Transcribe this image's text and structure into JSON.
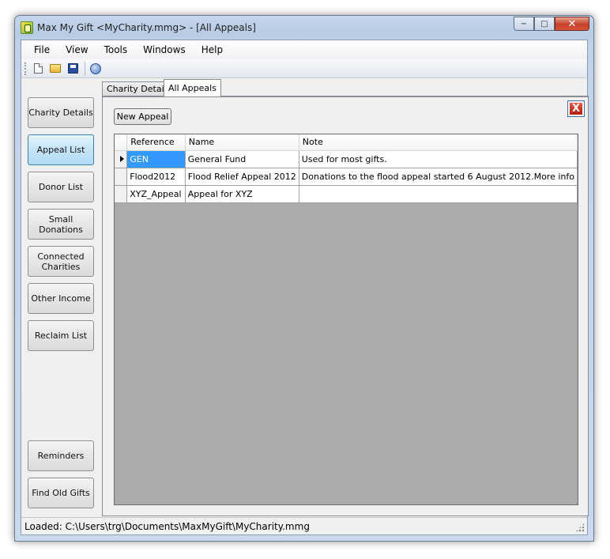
{
  "window": {
    "title": "Max My Gift <MyCharity.mmg>  - [All Appeals]",
    "minimize_label": "−",
    "maximize_label": "□",
    "close_label": "✕"
  },
  "menu": {
    "file": "File",
    "view": "View",
    "tools": "Tools",
    "windows": "Windows",
    "help": "Help"
  },
  "toolbar": {
    "icons": [
      "new-document-icon",
      "open-folder-icon",
      "save-disk-icon",
      "database-icon"
    ]
  },
  "sidebar": {
    "charity_details": "Charity Details",
    "appeal_list": "Appeal List",
    "donor_list": "Donor List",
    "small_donations_1": "Small",
    "small_donations_2": "Donations",
    "connected_charities_1": "Connected",
    "connected_charities_2": "Charities",
    "other_income": "Other Income",
    "reclaim_list": "Reclaim List",
    "reminders": "Reminders",
    "find_old_gifts": "Find Old Gifts",
    "active": "Appeal List"
  },
  "tabs": {
    "charity_details": "Charity Details",
    "all_appeals": "All Appeals",
    "active": "All Appeals"
  },
  "panel": {
    "new_appeal": "New Appeal",
    "close_label": "X"
  },
  "grid": {
    "columns": {
      "reference": "Reference",
      "name": "Name",
      "note": "Note"
    },
    "rows": [
      {
        "reference": "GEN",
        "name": "General Fund",
        "note": "Used for most gifts."
      },
      {
        "reference": "Flood2012",
        "name": "Flood Relief Appeal 2012",
        "note": "Donations to the flood appeal started 6 August 2012.More info"
      },
      {
        "reference": "XYZ_Appeal",
        "name": "Appeal for XYZ",
        "note": ""
      }
    ]
  },
  "status": {
    "text": "Loaded: C:\\Users\\trg\\Documents\\MaxMyGift\\MyCharity.mmg"
  },
  "colors": {
    "selection": "#3399ff",
    "active_nav": "#c4e4f8",
    "grid_background": "#ababab"
  }
}
